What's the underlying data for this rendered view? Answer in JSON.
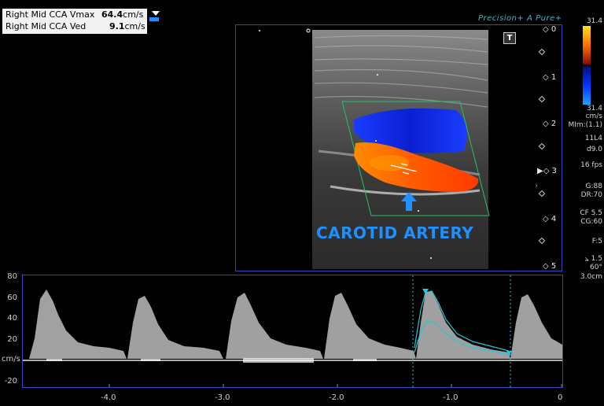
{
  "measurements": [
    {
      "label": "Right Mid CCA Vmax",
      "value": "64.4",
      "unit": "cm/s"
    },
    {
      "label": "Right Mid CCA Ved",
      "value": "9.1",
      "unit": "cm/s"
    }
  ],
  "brand": "Precision+ A Pure+",
  "image_icon": "T",
  "depth_scale": [
    "0",
    "1",
    "2",
    "3",
    "4",
    "5"
  ],
  "color_scale": {
    "top": "31.4",
    "bottom": "31.4",
    "unit": "cm/s",
    "colors": {
      "top": "#ffe21a",
      "mid_pos": "#ff4a00",
      "mid_neg": "#0033ff",
      "bottom": "#1fa0ff"
    }
  },
  "settings": {
    "mi": "MIm:(1.1)",
    "probe": "11L4",
    "depth": "d9.0",
    "fps": "16 fps",
    "gain": "G:88",
    "dr": "DR:70",
    "cf": "CF 5.5",
    "cg": "CG:60",
    "filter": "F:5",
    "scale_val": "1.5",
    "angle": "60°",
    "gate": "3.0cm"
  },
  "caption": "CAROTID ARTERY",
  "doppler": {
    "unit": "cm/s",
    "y_labels": [
      "80",
      "60",
      "40",
      "20",
      "-20"
    ],
    "x_labels": [
      "-4.0",
      "-3.0",
      "-2.0",
      "-1.0",
      "0"
    ]
  },
  "colors": {
    "accent": "#1e90ff",
    "frame": "#3b43c4",
    "roi": "#22c16b",
    "trace": "#25c6d6"
  }
}
